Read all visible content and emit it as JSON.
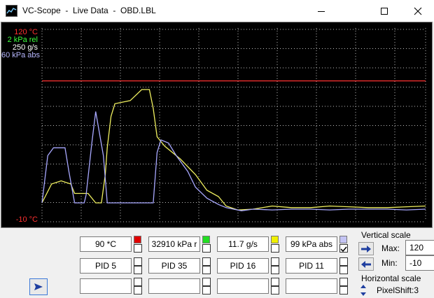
{
  "window": {
    "title": "VC-Scope  -  Live Data  -  OBD.LBL"
  },
  "scope": {
    "y_labels": [
      {
        "text": "120 °C",
        "color": "#ff3030"
      },
      {
        "text": "2 kPa rel",
        "color": "#3cff3c"
      },
      {
        "text": "250 g/s",
        "color": "#ffffff"
      },
      {
        "text": "60 kPa abs",
        "color": "#b8b8ff"
      }
    ],
    "y_min_label": {
      "text": "-10 °C",
      "color": "#ff3030"
    }
  },
  "channels": [
    {
      "value": "90 *C",
      "pid": "PID 5",
      "color": "#e00000",
      "checked": false
    },
    {
      "value": "32910 kPa r",
      "pid": "PID 35",
      "color": "#22dd22",
      "checked": false
    },
    {
      "value": "11.7 g/s",
      "pid": "PID 16",
      "color": "#f0f000",
      "checked": false
    },
    {
      "value": "99 kPa abs",
      "pid": "PID 11",
      "color": "#c4c4f4",
      "checked": true
    }
  ],
  "vertical_scale": {
    "label": "Vertical scale",
    "max_label": "Max:",
    "max_value": "120",
    "min_label": "Min:",
    "min_value": "-10"
  },
  "horizontal_scale": {
    "label": "Horizontal scale",
    "pixelshift": "PixelShift:3"
  },
  "chart_data": {
    "type": "line",
    "series": [
      {
        "name": "PID 5",
        "color": "#ff3030",
        "values": [
          [
            0,
            0.775
          ],
          [
            1,
            0.775
          ]
        ]
      },
      {
        "name": "PID 16",
        "color": "#f0f060",
        "values": [
          [
            0,
            0.0
          ],
          [
            0.025,
            0.12
          ],
          [
            0.05,
            0.14
          ],
          [
            0.075,
            0.12
          ],
          [
            0.085,
            0.06
          ],
          [
            0.12,
            0.06
          ],
          [
            0.14,
            0.0
          ],
          [
            0.155,
            0.0
          ],
          [
            0.165,
            0.18
          ],
          [
            0.17,
            0.35
          ],
          [
            0.18,
            0.55
          ],
          [
            0.19,
            0.63
          ],
          [
            0.23,
            0.65
          ],
          [
            0.26,
            0.72
          ],
          [
            0.28,
            0.72
          ],
          [
            0.29,
            0.6
          ],
          [
            0.3,
            0.42
          ],
          [
            0.32,
            0.36
          ],
          [
            0.36,
            0.28
          ],
          [
            0.4,
            0.18
          ],
          [
            0.43,
            0.08
          ],
          [
            0.46,
            0.04
          ],
          [
            0.48,
            -0.02
          ],
          [
            0.51,
            -0.045
          ],
          [
            0.55,
            -0.04
          ],
          [
            0.6,
            -0.02
          ],
          [
            0.65,
            -0.03
          ],
          [
            0.7,
            -0.03
          ],
          [
            0.75,
            -0.02
          ],
          [
            0.8,
            -0.025
          ],
          [
            0.85,
            -0.03
          ],
          [
            0.9,
            -0.03
          ],
          [
            0.95,
            -0.025
          ],
          [
            1,
            -0.02
          ]
        ]
      },
      {
        "name": "PID 11",
        "color": "#a8a8ff",
        "values": [
          [
            0,
            0.0
          ],
          [
            0.015,
            0.3
          ],
          [
            0.03,
            0.35
          ],
          [
            0.06,
            0.35
          ],
          [
            0.07,
            0.2
          ],
          [
            0.085,
            0.0
          ],
          [
            0.11,
            0.0
          ],
          [
            0.115,
            0.05
          ],
          [
            0.13,
            0.38
          ],
          [
            0.14,
            0.58
          ],
          [
            0.16,
            0.3
          ],
          [
            0.17,
            0.0
          ],
          [
            0.29,
            0.0
          ],
          [
            0.3,
            0.32
          ],
          [
            0.31,
            0.4
          ],
          [
            0.33,
            0.38
          ],
          [
            0.35,
            0.3
          ],
          [
            0.38,
            0.2
          ],
          [
            0.4,
            0.1
          ],
          [
            0.43,
            0.03
          ],
          [
            0.46,
            -0.01
          ],
          [
            0.48,
            -0.03
          ],
          [
            0.52,
            -0.05
          ],
          [
            0.55,
            -0.04
          ],
          [
            0.6,
            -0.045
          ],
          [
            0.65,
            -0.04
          ],
          [
            0.7,
            -0.04
          ],
          [
            0.75,
            -0.045
          ],
          [
            0.8,
            -0.04
          ],
          [
            0.85,
            -0.04
          ],
          [
            0.9,
            -0.04
          ],
          [
            0.95,
            -0.045
          ],
          [
            1,
            -0.04
          ]
        ]
      }
    ]
  }
}
